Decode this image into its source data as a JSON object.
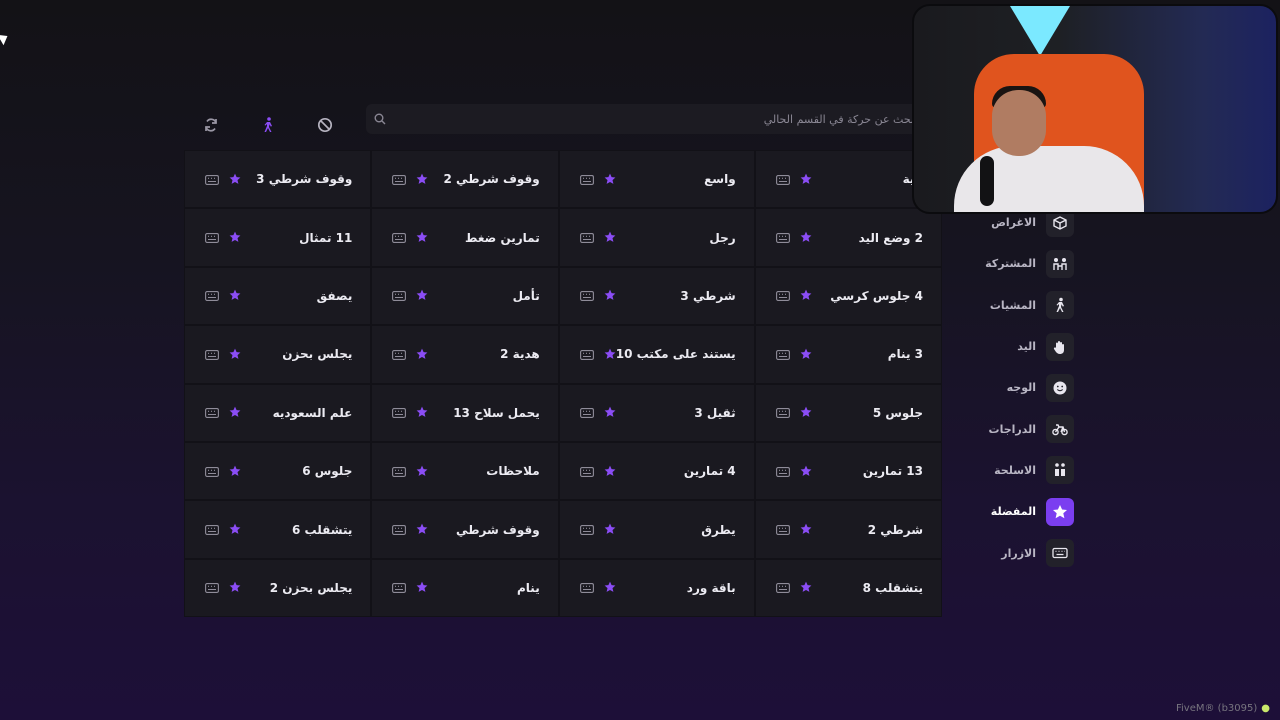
{
  "search": {
    "placeholder": "بحث عن حركة في القسم الحالي"
  },
  "toolbar": {
    "icons": [
      "search-icon",
      "cancel-icon",
      "walk-icon",
      "refresh-icon"
    ],
    "accent": "#7b3ef0"
  },
  "grid": {
    "cells": [
      "عية",
      "واسع",
      "وقوف شرطي 2",
      "وقوف شرطي 3",
      "2 وضع اليد",
      "رجل",
      "تمارين ضغط",
      "11 تمثال",
      "4 جلوس كرسي",
      "شرطي 3",
      "تأمل",
      "يصفق",
      "3 ينام",
      "يستند على مكتب 10",
      "هدية 2",
      "يجلس بحزن",
      "جلوس 5",
      "ثقيل 3",
      "يحمل سلاح 13",
      "علم السعوديه",
      "13 تمارين",
      "4 تمارين",
      "ملاحظات",
      "جلوس 6",
      "شرطي 2",
      "يطرق",
      "وقوف شرطي",
      "يتشقلب 6",
      "يتشقلب 8",
      "باقة ورد",
      "ينام",
      "يجلس بحزن 2"
    ],
    "star_color": "#8b4df5"
  },
  "sidebar": {
    "items": [
      {
        "label": "الاغراض",
        "icon": "box-icon"
      },
      {
        "label": "المشتركة",
        "icon": "shared-icon"
      },
      {
        "label": "المشيات",
        "icon": "walk-icon"
      },
      {
        "label": "اليد",
        "icon": "hand-icon"
      },
      {
        "label": "الوجه",
        "icon": "face-icon"
      },
      {
        "label": "الدراجات",
        "icon": "bike-icon"
      },
      {
        "label": "الاسلحة",
        "icon": "weapon-icon"
      },
      {
        "label": "المفضلة",
        "icon": "star-icon",
        "active": true
      },
      {
        "label": "الازرار",
        "icon": "keyboard-icon"
      }
    ]
  },
  "footer": {
    "brand": "FiveM® (b3095)"
  }
}
